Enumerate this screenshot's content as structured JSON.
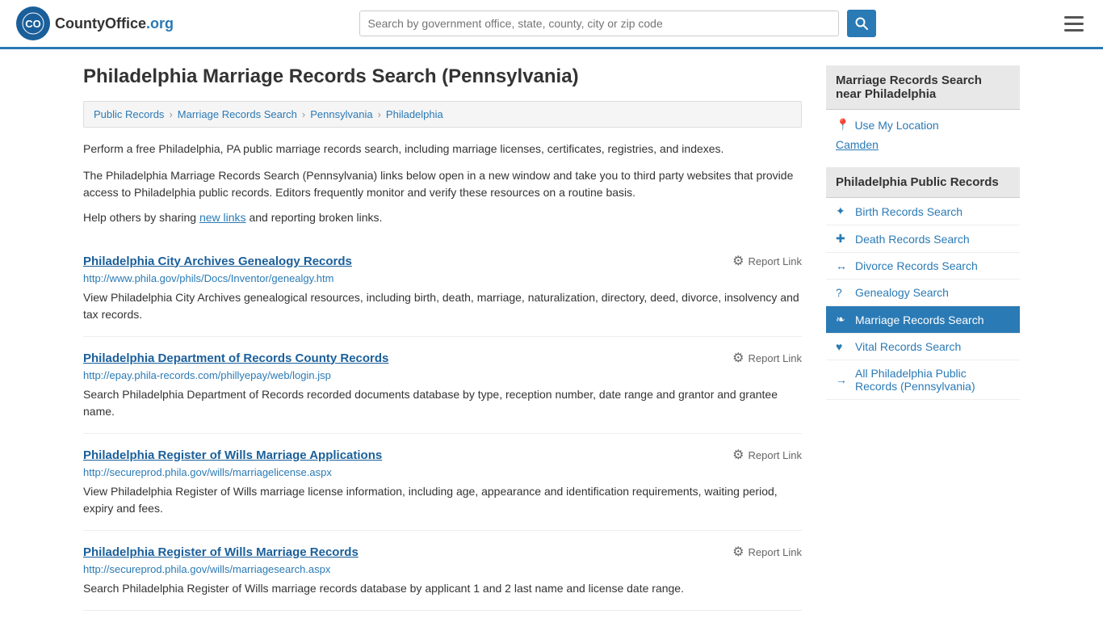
{
  "header": {
    "logo_text": "CountyOffice",
    "logo_org": ".org",
    "search_placeholder": "Search by government office, state, county, city or zip code",
    "search_value": ""
  },
  "page": {
    "title": "Philadelphia Marriage Records Search (Pennsylvania)",
    "breadcrumb": [
      {
        "label": "Public Records",
        "href": "#"
      },
      {
        "label": "Marriage Records Search",
        "href": "#"
      },
      {
        "label": "Pennsylvania",
        "href": "#"
      },
      {
        "label": "Philadelphia",
        "href": "#"
      }
    ],
    "intro1": "Perform a free Philadelphia, PA public marriage records search, including marriage licenses, certificates, registries, and indexes.",
    "intro2": "The Philadelphia Marriage Records Search (Pennsylvania) links below open in a new window and take you to third party websites that provide access to Philadelphia public records. Editors frequently monitor and verify these resources on a routine basis.",
    "help_prefix": "Help others by sharing ",
    "help_link": "new links",
    "help_suffix": " and reporting broken links.",
    "records": [
      {
        "title": "Philadelphia City Archives Genealogy Records",
        "url": "http://www.phila.gov/phils/Docs/Inventor/genealgy.htm",
        "desc": "View Philadelphia City Archives genealogical resources, including birth, death, marriage, naturalization, directory, deed, divorce, insolvency and tax records.",
        "report": "Report Link"
      },
      {
        "title": "Philadelphia Department of Records County Records",
        "url": "http://epay.phila-records.com/phillyepay/web/login.jsp",
        "desc": "Search Philadelphia Department of Records recorded documents database by type, reception number, date range and grantor and grantee name.",
        "report": "Report Link"
      },
      {
        "title": "Philadelphia Register of Wills Marriage Applications",
        "url": "http://secureprod.phila.gov/wills/marriagelicense.aspx",
        "desc": "View Philadelphia Register of Wills marriage license information, including age, appearance and identification requirements, waiting period, expiry and fees.",
        "report": "Report Link"
      },
      {
        "title": "Philadelphia Register of Wills Marriage Records",
        "url": "http://secureprod.phila.gov/wills/marriagesearch.aspx",
        "desc": "Search Philadelphia Register of Wills marriage records database by applicant 1 and 2 last name and license date range.",
        "report": "Report Link"
      }
    ]
  },
  "sidebar": {
    "nearby_header": "Marriage Records Search near Philadelphia",
    "use_location": "Use My Location",
    "nearby_city": "Camden",
    "public_records_header": "Philadelphia Public Records",
    "public_records_items": [
      {
        "label": "Birth Records Search",
        "icon": "✦",
        "active": false
      },
      {
        "label": "Death Records Search",
        "icon": "✚",
        "active": false
      },
      {
        "label": "Divorce Records Search",
        "icon": "↔",
        "active": false
      },
      {
        "label": "Genealogy Search",
        "icon": "?",
        "active": false
      },
      {
        "label": "Marriage Records Search",
        "icon": "❧",
        "active": true
      },
      {
        "label": "Vital Records Search",
        "icon": "♥",
        "active": false
      },
      {
        "label": "All Philadelphia Public Records (Pennsylvania)",
        "icon": "→",
        "active": false
      }
    ]
  }
}
